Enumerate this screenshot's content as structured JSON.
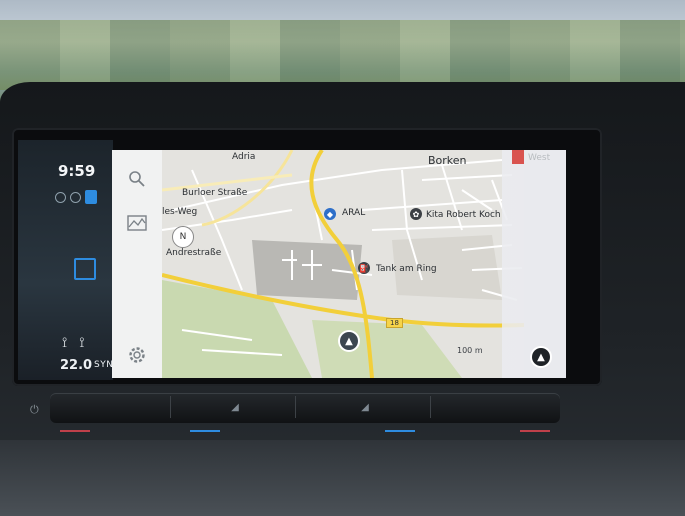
{
  "status": {
    "time": "9:59"
  },
  "climate": {
    "temp": "22.0",
    "sync": "SYNC"
  },
  "side_menu": {
    "search_icon": "search-icon",
    "map_icon": "map-layers-icon",
    "settings_icon": "gear-icon"
  },
  "map": {
    "labels": {
      "adria": "Adria",
      "borken": "Borken",
      "west": "West",
      "burloer": "Burloer Straße",
      "weg": "les-Weg",
      "aral": "ARAL",
      "kita": "Kita Robert Koch",
      "tank": "Tank am Ring",
      "andre": "Andrestraße"
    },
    "road_number": "18",
    "scale": "100 m",
    "compass": "N"
  },
  "colors": {
    "accent": "#2e8ce0",
    "major_road": "#f2cf3a",
    "park": "#c7d8ad"
  }
}
